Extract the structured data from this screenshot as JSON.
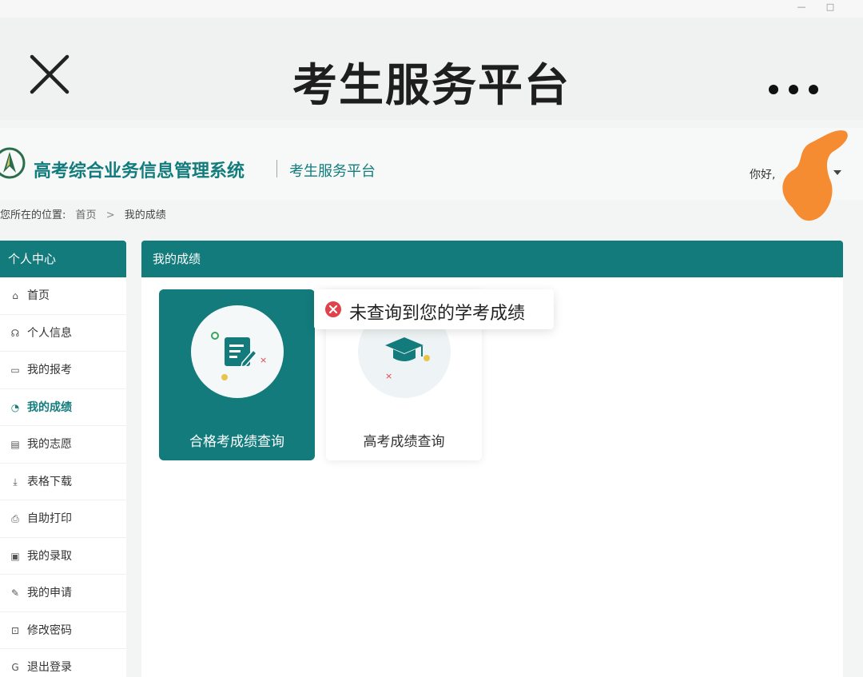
{
  "window": {
    "minimize_glyph": "—",
    "maximize_glyph": "□"
  },
  "titlebar": {
    "title": "考生服务平台",
    "close_icon": "close-icon",
    "more_icon": "more-icon"
  },
  "header": {
    "system_name": "高考综合业务信息管理系统",
    "platform_name": "考生服务平台",
    "greeting": "你好,"
  },
  "breadcrumb": {
    "prefix": "您所在的位置:",
    "home": "首页",
    "separator": ">",
    "current": "我的成绩"
  },
  "sidebar": {
    "title": "个人中心",
    "items": [
      {
        "label": "首页",
        "icon": "⌂"
      },
      {
        "label": "个人信息",
        "icon": "☊"
      },
      {
        "label": "我的报考",
        "icon": "▭"
      },
      {
        "label": "我的成绩",
        "icon": "◔"
      },
      {
        "label": "我的志愿",
        "icon": "▤"
      },
      {
        "label": "表格下载",
        "icon": "⤓"
      },
      {
        "label": "自助打印",
        "icon": "⎙"
      },
      {
        "label": "我的录取",
        "icon": "▣"
      },
      {
        "label": "我的申请",
        "icon": "✎"
      },
      {
        "label": "修改密码",
        "icon": "⊡"
      },
      {
        "label": "退出登录",
        "icon": "G"
      }
    ],
    "active_index": 3
  },
  "main": {
    "title": "我的成绩",
    "cards": [
      {
        "label": "合格考成绩查询",
        "icon": "document-edit-icon"
      },
      {
        "label": "高考成绩查询",
        "icon": "graduation-cap-icon"
      }
    ]
  },
  "toast": {
    "message": "未查询到您的学考成绩",
    "icon": "error-icon"
  },
  "colors": {
    "primary": "#137b7c",
    "redaction": "#f5821f",
    "error": "#e0424a"
  }
}
